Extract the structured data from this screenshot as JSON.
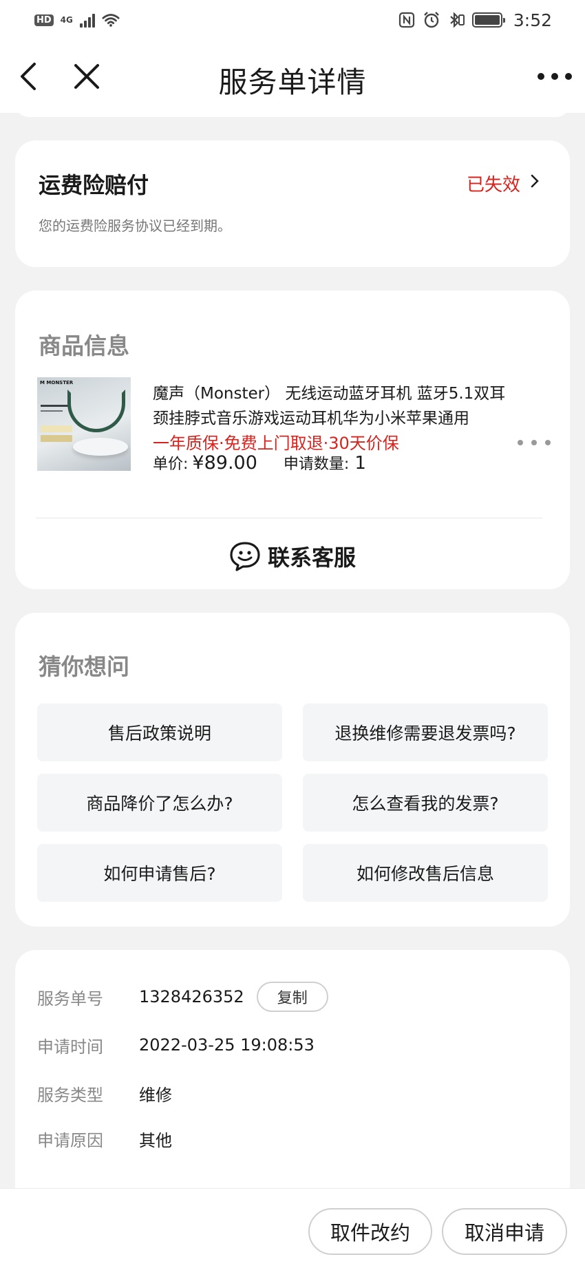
{
  "status_bar": {
    "hd_badge": "HD",
    "network": "4G",
    "time": "3:52",
    "icons": [
      "hd-icon",
      "signal-icon",
      "wifi-icon",
      "nfc-icon",
      "alarm-icon",
      "bluetooth-icon",
      "battery-icon"
    ]
  },
  "nav": {
    "title": "服务单详情",
    "back_icon": "chevron-left-icon",
    "close_icon": "close-icon",
    "more_icon": "more-horizontal-icon"
  },
  "freight": {
    "title": "运费险赔付",
    "status": "已失效",
    "description": "您的运费险服务协议已经到期。"
  },
  "product_section": {
    "title": "商品信息",
    "product": {
      "name": "魔声（Monster） 无线运动蓝牙耳机 蓝牙5.1双耳颈挂脖式音乐游戏运动耳机华为小米苹果通用",
      "tags": "一年质保·免费上门取退·30天价保",
      "price_label": "单价:",
      "price": "¥89.00",
      "qty_label": "申请数量:",
      "qty": "1",
      "thumb_brand": "M MONSTER"
    },
    "contact_label": "联系客服"
  },
  "faq": {
    "title": "猜你想问",
    "items": [
      "售后政策说明",
      "退换维修需要退发票吗?",
      "商品降价了怎么办?",
      "怎么查看我的发票?",
      "如何申请售后?",
      "如何修改售后信息"
    ]
  },
  "details": {
    "rows": [
      {
        "label": "服务单号",
        "value": "1328426352"
      },
      {
        "label": "申请时间",
        "value": "2022-03-25 19:08:53"
      },
      {
        "label": "服务类型",
        "value": "维修"
      },
      {
        "label": "申请原因",
        "value": "其他"
      }
    ],
    "copy_label": "复制"
  },
  "actions": {
    "change_pickup": "取件改约",
    "cancel_request": "取消申请"
  },
  "colors": {
    "accent_red": "#d8231d",
    "page_bg": "#f2f2f2",
    "card_bg": "#ffffff",
    "faq_btn_bg": "#f4f5f7"
  }
}
